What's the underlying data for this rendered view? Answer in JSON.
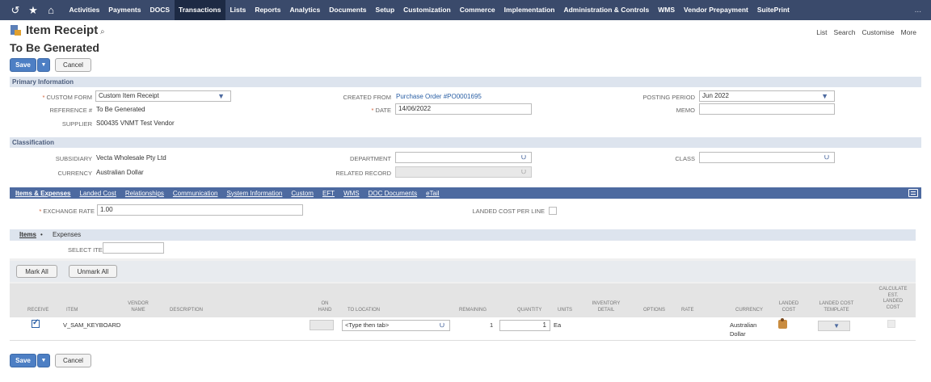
{
  "topnav": {
    "icons": [
      "history-icon",
      "star-icon",
      "home-icon"
    ],
    "items": [
      "Activities",
      "Payments",
      "DOCS",
      "Transactions",
      "Lists",
      "Reports",
      "Analytics",
      "Documents",
      "Setup",
      "Customization",
      "Commerce",
      "Implementation",
      "Administration & Controls",
      "WMS",
      "Vendor Prepayment",
      "SuitePrint"
    ],
    "active": "Transactions",
    "more": "..."
  },
  "header": {
    "title": "Item Receipt",
    "subtitle": "To Be Generated",
    "links": [
      "List",
      "Search",
      "Customise",
      "More"
    ]
  },
  "buttons": {
    "save": "Save",
    "dropdown": "▼",
    "cancel": "Cancel",
    "mark_all": "Mark All",
    "unmark_all": "Unmark All"
  },
  "primary": {
    "section_title": "Primary Information",
    "custom_form_label": "CUSTOM FORM",
    "custom_form_value": "Custom Item Receipt",
    "reference_label": "REFERENCE #",
    "reference_value": "To Be Generated",
    "supplier_label": "SUPPLIER",
    "supplier_value": "S00435 VNMT Test Vendor",
    "created_from_label": "CREATED FROM",
    "created_from_value": "Purchase Order #PO0001695",
    "date_label": "DATE",
    "date_value": "14/06/2022",
    "posting_period_label": "POSTING PERIOD",
    "posting_period_value": "Jun 2022",
    "memo_label": "MEMO",
    "memo_value": ""
  },
  "classification": {
    "section_title": "Classification",
    "subsidiary_label": "SUBSIDIARY",
    "subsidiary_value": "Vecta Wholesale Pty Ltd",
    "currency_label": "CURRENCY",
    "currency_value": "Australian Dollar",
    "department_label": "DEPARTMENT",
    "related_record_label": "RELATED RECORD",
    "class_label": "CLASS"
  },
  "subtabs": [
    "Items & Expenses",
    "Landed Cost",
    "Relationships",
    "Communication",
    "System Information",
    "Custom",
    "EFT",
    "WMS",
    "DOC Documents",
    "eTail"
  ],
  "items_section": {
    "exchange_rate_label": "EXCHANGE RATE",
    "exchange_rate_value": "1.00",
    "landed_cost_per_line_label": "LANDED COST PER LINE",
    "tab_items": "Items",
    "tab_items_marker": "•",
    "tab_expenses": "Expenses",
    "select_item_label": "SELECT ITEM",
    "columns": {
      "receive": "RECEIVE",
      "item": "ITEM",
      "vendor_name_1": "VENDOR",
      "vendor_name_2": "NAME",
      "description": "DESCRIPTION",
      "on_hand_1": "ON",
      "on_hand_2": "HAND",
      "to_location": "TO LOCATION",
      "remaining": "REMAINING",
      "quantity": "QUANTITY",
      "units": "UNITS",
      "inventory_detail_1": "INVENTORY",
      "inventory_detail_2": "DETAIL",
      "options": "OPTIONS",
      "rate": "RATE",
      "currency": "CURRENCY",
      "landed_cost_1": "LANDED",
      "landed_cost_2": "COST",
      "landed_cost_template_1": "LANDED COST",
      "landed_cost_template_2": "TEMPLATE",
      "calc_1": "CALCULATE",
      "calc_2": "EST.",
      "calc_3": "LANDED",
      "calc_4": "COST"
    },
    "row": {
      "item": "V_SAM_KEYBOARD",
      "to_location": "<Type then tab>",
      "remaining": "1",
      "quantity": "1",
      "units": "Ea",
      "currency_1": "Australian",
      "currency_2": "Dollar"
    }
  },
  "colors": {
    "nav_bg": "#3a4a6b",
    "nav_active": "#1d2a44",
    "section_bg": "#dde4ee",
    "subtab_bg": "#4d6aa0",
    "primary_button": "#4d7fc4",
    "link": "#2a5fa5",
    "required": "#d25c33"
  }
}
